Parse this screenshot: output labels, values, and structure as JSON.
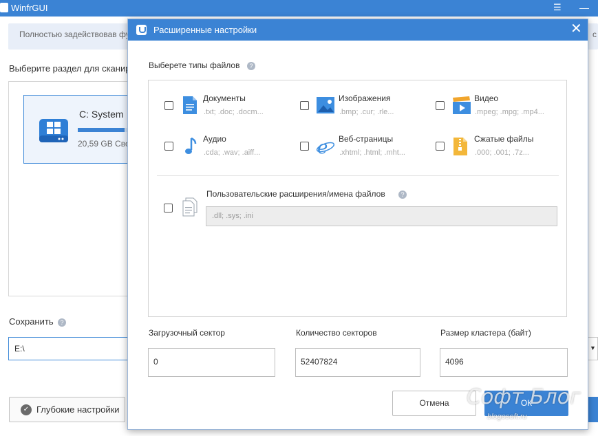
{
  "app": {
    "title": "WinfrGUI",
    "menu_icon": "hamburger-icon",
    "minimize_icon": "minimize-icon"
  },
  "banner": {
    "text": "Полностью задействовав фу",
    "tail": "с"
  },
  "section": {
    "label": "Выберите раздел для сканиро"
  },
  "drive": {
    "name": "C: System",
    "size": "20,59 GB Своб",
    "usage_fraction": 0.85,
    "icon": "windows-drive-icon"
  },
  "save": {
    "label": "Сохранить",
    "help": "?",
    "path": "E:\\"
  },
  "deep_settings": {
    "label": "Глубокие настройки",
    "icon": "check-circle-icon"
  },
  "modal": {
    "title": "Расширенные настройки",
    "close": "✕",
    "file_types_title": "Выберете типы файлов",
    "help": "?",
    "file_types": [
      {
        "name": "Документы",
        "ext": ".txt; .doc; .docm...",
        "icon": "document-icon"
      },
      {
        "name": "Изображения",
        "ext": ".bmp; .cur; .rle...",
        "icon": "image-icon"
      },
      {
        "name": "Видео",
        "ext": ".mpeg; .mpg; .mp4...",
        "icon": "video-icon"
      },
      {
        "name": "Аудио",
        "ext": ".cda; .wav; .aiff...",
        "icon": "music-note-icon"
      },
      {
        "name": "Веб-страницы",
        "ext": ".xhtml; .html; .mht...",
        "icon": "browser-icon"
      },
      {
        "name": "Сжатые файлы",
        "ext": ".000; .001; .7z...",
        "icon": "archive-icon"
      }
    ],
    "custom": {
      "label": "Пользовательские расширения/имена файлов",
      "placeholder": ".dll; .sys; .ini",
      "icon": "files-icon"
    },
    "fields": [
      {
        "label": "Загрузочный сектор",
        "value": "0"
      },
      {
        "label": "Количество секторов",
        "value": "52407824"
      },
      {
        "label": "Размер кластера (байт)",
        "value": "4096"
      }
    ],
    "cancel_label": "Отмена",
    "ok_label": "ОК"
  },
  "watermark": {
    "line1": "Софт Блог",
    "line2": "blogosoft.ru"
  },
  "colors": {
    "accent": "#3b83d4",
    "banner": "#e8eef8"
  }
}
